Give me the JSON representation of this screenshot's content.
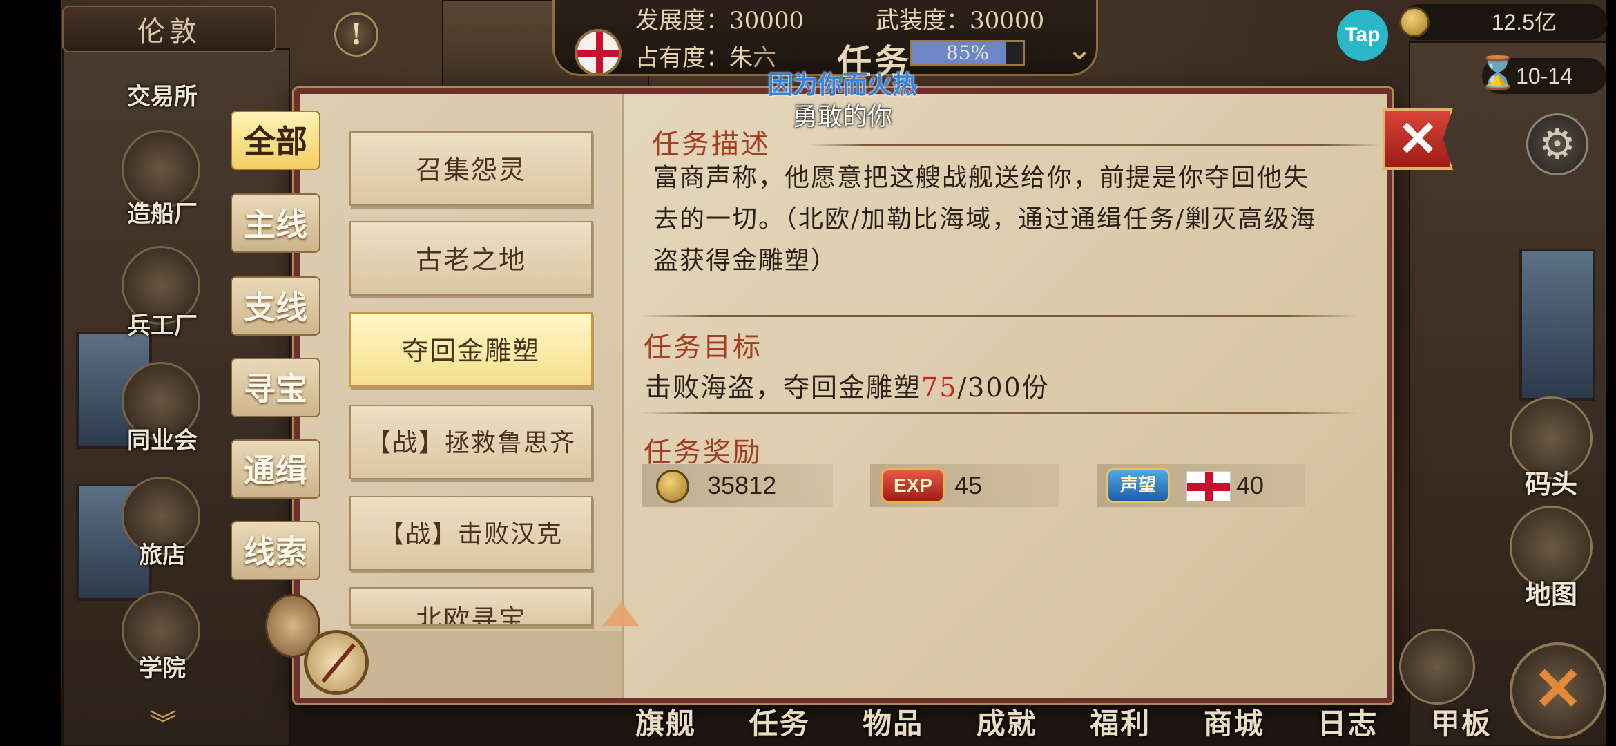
{
  "top": {
    "city": "伦敦",
    "development": "发展度：30000",
    "armament": "武装度：30000",
    "occupancy": "占有度：朱",
    "occupancy_tail": "六",
    "occupancy_progress_text": "85%",
    "occupancy_progress": 0.85,
    "title": "任务",
    "money": "12.5亿",
    "date": "10-14",
    "tap_label": "Tap"
  },
  "subtitle": {
    "line1": "因为你而火热",
    "line2": "勇敢的你"
  },
  "left_nav": [
    {
      "label": "交易所"
    },
    {
      "label": "造船厂"
    },
    {
      "label": "兵工厂"
    },
    {
      "label": "同业会"
    },
    {
      "label": "旅店"
    },
    {
      "label": "学院"
    }
  ],
  "categories": [
    {
      "label": "全部",
      "active": true
    },
    {
      "label": "主线",
      "active": false
    },
    {
      "label": "支线",
      "active": false
    },
    {
      "label": "寻宝",
      "active": false
    },
    {
      "label": "通缉",
      "active": false
    },
    {
      "label": "线索",
      "active": false
    }
  ],
  "quests": [
    {
      "label": "召集怨灵",
      "active": false
    },
    {
      "label": "古老之地",
      "active": false
    },
    {
      "label": "夺回金雕塑",
      "active": true
    },
    {
      "label": "【战】拯救鲁思齐",
      "active": false
    },
    {
      "label": "【战】击败汉克",
      "active": false
    },
    {
      "label": "北欧寻宝",
      "active": false
    }
  ],
  "detail": {
    "desc_title": "任务描述",
    "desc_text": "富商声称，他愿意把这艘战舰送给你，前提是你夺回他失去的一切。（北欧/加勒比海域，通过通缉任务/剿灭高级海盗获得金雕塑）",
    "goal_title": "任务目标",
    "goal_prefix": "击败海盗，夺回金雕塑",
    "goal_current": "75",
    "goal_suffix": "/300份",
    "reward_title": "任务奖励",
    "rewards": {
      "gold": "35812",
      "exp_badge": "EXP",
      "exp": "45",
      "rep_badge": "声望",
      "rep": "40"
    }
  },
  "right_nav": [
    {
      "label": "码头"
    },
    {
      "label": "地图"
    }
  ],
  "bottom_nav": [
    "旗舰",
    "任务",
    "物品",
    "成就",
    "福利",
    "商城",
    "日志",
    "甲板"
  ],
  "colors": {
    "accent_red": "#c8221e",
    "section_title": "#a43e22",
    "panel_border": "#6c2f2b",
    "active_tab": "#f2cf62",
    "subtitle_blue": "#2f83e6"
  },
  "icons": {
    "alert": "exclamation-icon",
    "close": "close-icon",
    "settings": "gear-icon",
    "date": "hourglass-icon",
    "currency": "gold-coin-icon",
    "nation": "england-flag-icon"
  }
}
